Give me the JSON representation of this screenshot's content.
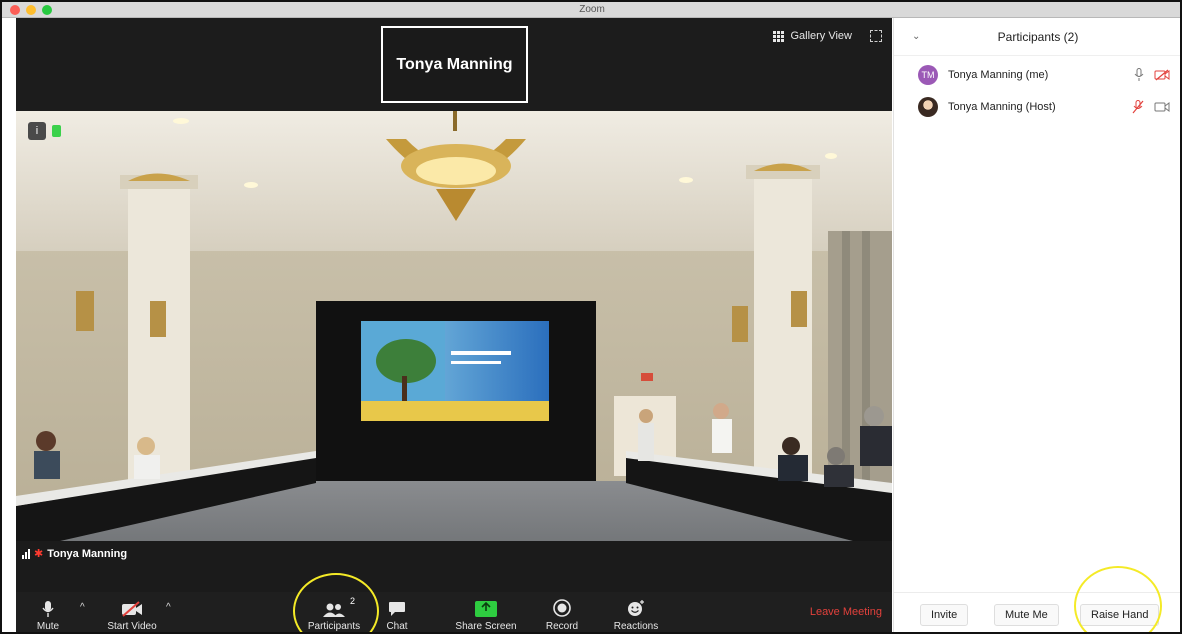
{
  "window": {
    "title": "Zoom"
  },
  "video": {
    "thumbnail_name": "Tonya Manning",
    "gallery_view_label": "Gallery View",
    "active_speaker_name": "Tonya Manning",
    "info_badge": "i"
  },
  "toolbar": {
    "mute_label": "Mute",
    "start_video_label": "Start Video",
    "participants_label": "Participants",
    "participants_count": "2",
    "chat_label": "Chat",
    "share_screen_label": "Share Screen",
    "record_label": "Record",
    "reactions_label": "Reactions",
    "leave_label": "Leave Meeting"
  },
  "panel": {
    "title": "Participants (2)",
    "participants": [
      {
        "name": "Tonya Manning (me)",
        "initials": "TM",
        "avatar_color": "#9b59b6"
      },
      {
        "name": "Tonya Manning (Host)"
      }
    ],
    "footer": {
      "invite_label": "Invite",
      "mute_me_label": "Mute Me",
      "raise_hand_label": "Raise Hand"
    }
  },
  "colors": {
    "highlight": "#f4ea27",
    "leave": "#e2413c",
    "share_green": "#2ecc40",
    "muted_red": "#e2413c"
  }
}
